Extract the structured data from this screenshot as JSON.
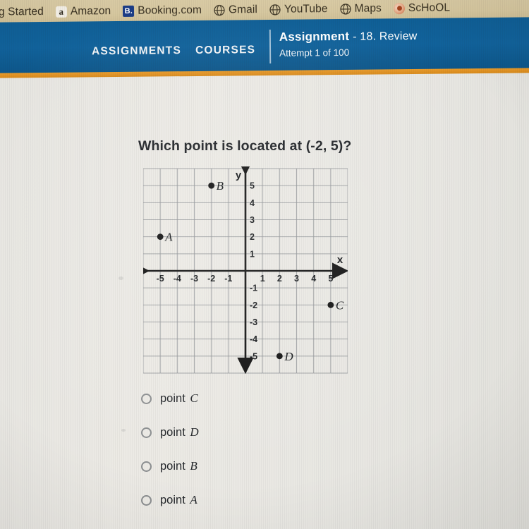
{
  "browser": {
    "bookmarks": [
      {
        "label": "g Started",
        "icon": "none"
      },
      {
        "label": "Amazon",
        "icon": "amazon-icon"
      },
      {
        "label": "Booking.com",
        "icon": "booking-icon"
      },
      {
        "label": "Gmail",
        "icon": "globe-icon"
      },
      {
        "label": "YouTube",
        "icon": "globe-icon"
      },
      {
        "label": "Maps",
        "icon": "globe-icon"
      },
      {
        "label": "ScHoOL",
        "icon": "school-icon"
      }
    ]
  },
  "nav": {
    "assignments_label": "ASSIGNMENTS",
    "courses_label": "COURSES",
    "assignment_title": "Assignment",
    "assignment_subtitle": "- 18. Review",
    "attempt_text": "Attempt 1 of 100",
    "bar_color": "#11629b",
    "accent_color": "#e08c1e"
  },
  "question": {
    "text": "Which point is located at (-2, 5)?"
  },
  "answers": [
    {
      "label": "point",
      "point": "C",
      "selected": false
    },
    {
      "label": "point",
      "point": "D",
      "selected": false
    },
    {
      "label": "point",
      "point": "B",
      "selected": false
    },
    {
      "label": "point",
      "point": "A",
      "selected": false
    }
  ],
  "chart_data": {
    "type": "scatter",
    "title": "",
    "xlabel": "x",
    "ylabel": "y",
    "xlim": [
      -6,
      6
    ],
    "ylim": [
      -6,
      6
    ],
    "grid": true,
    "xticks": [
      -5,
      -4,
      -3,
      -2,
      -1,
      1,
      2,
      3,
      4,
      5
    ],
    "yticks": [
      5,
      4,
      3,
      2,
      1,
      -1,
      -2,
      -3,
      -4,
      -5
    ],
    "xtick_labels": [
      "-5",
      "-4",
      "-3",
      "-2",
      "-1",
      "1",
      "2",
      "3",
      "4",
      "5"
    ],
    "ytick_labels": [
      "5",
      "4",
      "3",
      "2",
      "1",
      "-1",
      "-2",
      "-3",
      "-4",
      "-5"
    ],
    "points": [
      {
        "name": "B",
        "x": -2,
        "y": 5,
        "label_side": "right"
      },
      {
        "name": "A",
        "x": -5,
        "y": 2,
        "label_side": "right"
      },
      {
        "name": "C",
        "x": 5,
        "y": -2,
        "label_side": "right"
      },
      {
        "name": "D",
        "x": 2,
        "y": -5,
        "label_side": "right"
      }
    ],
    "point_color": "#111111",
    "axis_color": "#111111",
    "grid_color": "#8d9094"
  }
}
